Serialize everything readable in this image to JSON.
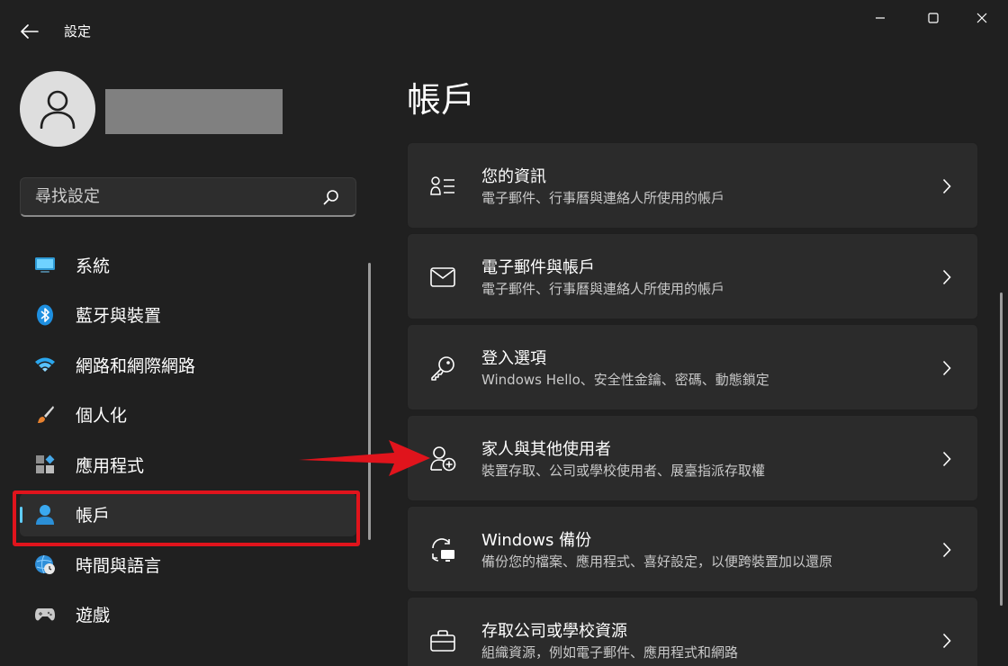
{
  "window": {
    "title": "設定",
    "back_icon": "arrow-left-icon",
    "controls": [
      "minimize-icon",
      "maximize-icon",
      "close-icon"
    ]
  },
  "user": {
    "avatar_icon": "person-icon"
  },
  "search": {
    "placeholder": "尋找設定",
    "value": "",
    "icon": "search-icon"
  },
  "sidebar": {
    "items": [
      {
        "label": "系統",
        "icon": "monitor-icon",
        "active": false
      },
      {
        "label": "藍牙與裝置",
        "icon": "bluetooth-icon",
        "active": false
      },
      {
        "label": "網路和網際網路",
        "icon": "wifi-icon",
        "active": false
      },
      {
        "label": "個人化",
        "icon": "brush-icon",
        "active": false
      },
      {
        "label": "應用程式",
        "icon": "apps-icon",
        "active": false
      },
      {
        "label": "帳戶",
        "icon": "account-icon",
        "active": true
      },
      {
        "label": "時間與語言",
        "icon": "globe-clock-icon",
        "active": false
      },
      {
        "label": "遊戲",
        "icon": "gamepad-icon",
        "active": false
      }
    ]
  },
  "main": {
    "title": "帳戶",
    "cards": [
      {
        "title": "您的資訊",
        "subtitle": "電子郵件、行事曆與連絡人所使用的帳戶",
        "icon": "user-info-icon"
      },
      {
        "title": "電子郵件與帳戶",
        "subtitle": "電子郵件、行事曆與連絡人所使用的帳戶",
        "icon": "mail-icon"
      },
      {
        "title": "登入選項",
        "subtitle": "Windows Hello、安全性金鑰、密碼、動態鎖定",
        "icon": "key-icon"
      },
      {
        "title": "家人與其他使用者",
        "subtitle": "裝置存取、公司或學校使用者、展臺指派存取權",
        "icon": "add-person-icon"
      },
      {
        "title": "Windows 備份",
        "subtitle": "備份您的檔案、應用程式、喜好設定，以便跨裝置加以還原",
        "icon": "sync-backup-icon"
      },
      {
        "title": "存取公司或學校資源",
        "subtitle": "組織資源，例如電子郵件、應用程式和網路",
        "icon": "briefcase-icon"
      }
    ]
  },
  "colors": {
    "background": "#202020",
    "card": "#2b2b2b",
    "accent": "#60cdff",
    "annotation": "#e0141c"
  }
}
